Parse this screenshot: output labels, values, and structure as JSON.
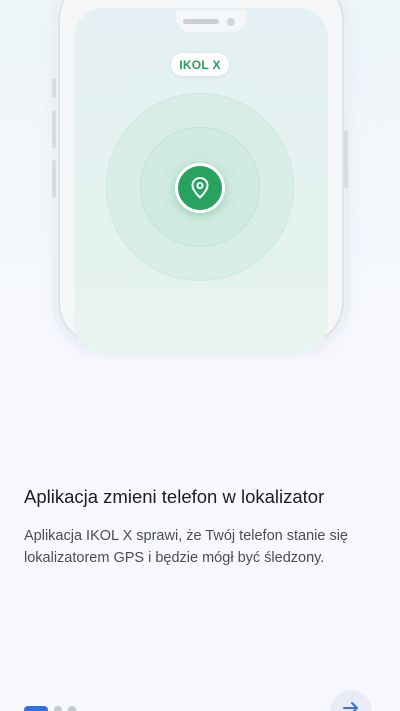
{
  "app_badge": "IKOL X",
  "onboarding": {
    "title": "Aplikacja zmieni telefon w lokalizator",
    "description": "Aplikacja IKOL X sprawi, że Twój telefon stanie się lokalizatorem GPS i będzie mógł być śledzony."
  },
  "pager": {
    "total": 3,
    "active_index": 0
  },
  "icons": {
    "hero_pin": "location-pin-icon",
    "next": "arrow-right-icon"
  },
  "colors": {
    "brand_green": "#28a35f",
    "accent_blue": "#3b6fd8",
    "title_text": "#1c1c22",
    "body_text": "#4a4d57"
  }
}
